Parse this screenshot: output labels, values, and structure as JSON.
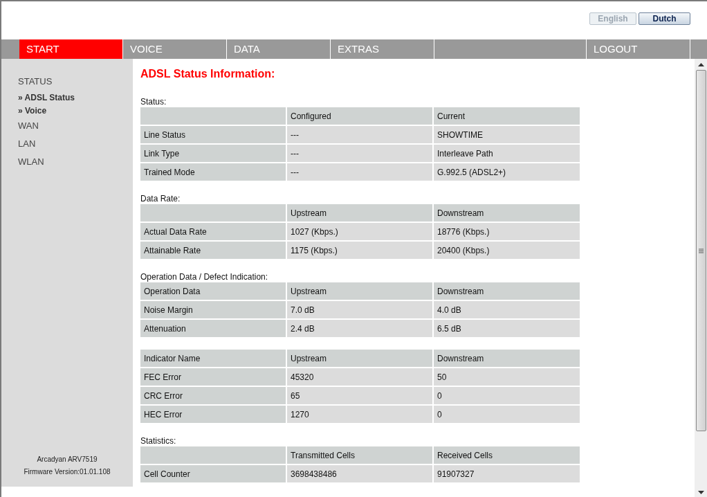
{
  "language_buttons": [
    {
      "label": "English",
      "selected": true
    },
    {
      "label": "Dutch",
      "selected": false
    }
  ],
  "nav": [
    {
      "label": "START",
      "selected": true
    },
    {
      "label": "VOICE",
      "selected": false
    },
    {
      "label": "DATA",
      "selected": false
    },
    {
      "label": "EXTRAS",
      "selected": false
    },
    {
      "label": "LOGOUT",
      "selected": false
    }
  ],
  "sidebar": {
    "items": [
      {
        "label": "STATUS",
        "children": [
          {
            "label": "» ADSL Status"
          },
          {
            "label": "» Voice"
          }
        ]
      },
      {
        "label": "WAN"
      },
      {
        "label": "LAN"
      },
      {
        "label": "WLAN"
      }
    ],
    "footer": [
      "Arcadyan ARV7519",
      "Firmware Version:01.01.108"
    ]
  },
  "title": "ADSL Status Information:",
  "sections": [
    {
      "label": "Status:",
      "columns": [
        "",
        "Configured",
        "Current"
      ],
      "rows": [
        [
          "Line Status",
          "---",
          "SHOWTIME"
        ],
        [
          "Link Type",
          "---",
          "Interleave Path"
        ],
        [
          "Trained Mode",
          "---",
          "G.992.5 (ADSL2+)"
        ]
      ]
    },
    {
      "label": "Data Rate:",
      "columns": [
        "",
        "Upstream",
        "Downstream"
      ],
      "rows": [
        [
          "Actual Data Rate",
          "1027 (Kbps.)",
          "18776 (Kbps.)"
        ],
        [
          "Attainable Rate",
          "1175 (Kbps.)",
          "20400 (Kbps.)"
        ]
      ]
    },
    {
      "label": "Operation Data / Defect Indication:",
      "columns": [
        "Operation Data",
        "Upstream",
        "Downstream"
      ],
      "rows": [
        [
          "Noise Margin",
          "7.0 dB",
          "4.0 dB"
        ],
        [
          "Attenuation",
          "2.4 dB",
          "6.5 dB"
        ]
      ]
    },
    {
      "columns": [
        "Indicator Name",
        "Upstream",
        "Downstream"
      ],
      "rows": [
        [
          "FEC Error",
          "45320",
          "50"
        ],
        [
          "CRC Error",
          "65",
          "0"
        ],
        [
          "HEC Error",
          "1270",
          "0"
        ]
      ]
    },
    {
      "label": "Statistics:",
      "columns": [
        "",
        "Transmitted Cells",
        "Received Cells"
      ],
      "rows": [
        [
          "Cell Counter",
          "3698438486",
          "91907327"
        ]
      ]
    }
  ]
}
